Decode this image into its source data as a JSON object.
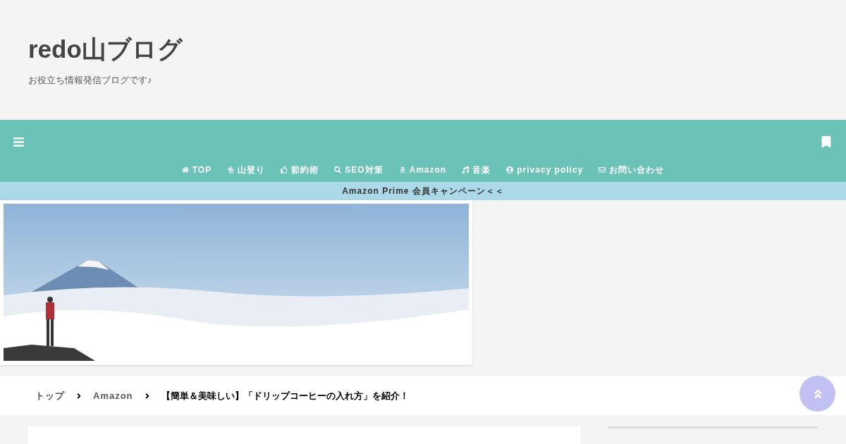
{
  "header": {
    "site_title": "redo山ブログ",
    "tagline": "お役立ち情報発信ブログです♪"
  },
  "nav": {
    "items": [
      {
        "label": "TOP"
      },
      {
        "label": "山登り"
      },
      {
        "label": "節約術"
      },
      {
        "label": "SEO対策"
      },
      {
        "label": "Amazon"
      },
      {
        "label": "音楽"
      },
      {
        "label": "privacy policy"
      },
      {
        "label": "お問い合わせ"
      }
    ]
  },
  "notice_bar": {
    "text": "Amazon Prime 会員キャンペーン＜＜"
  },
  "breadcrumb": [
    {
      "label": "トップ",
      "kind": "link"
    },
    {
      "label": "Amazon",
      "kind": "link"
    },
    {
      "label": "【簡単＆美味しい】「ドリップコーヒーの入れ方」を紹介！",
      "kind": "current"
    }
  ]
}
